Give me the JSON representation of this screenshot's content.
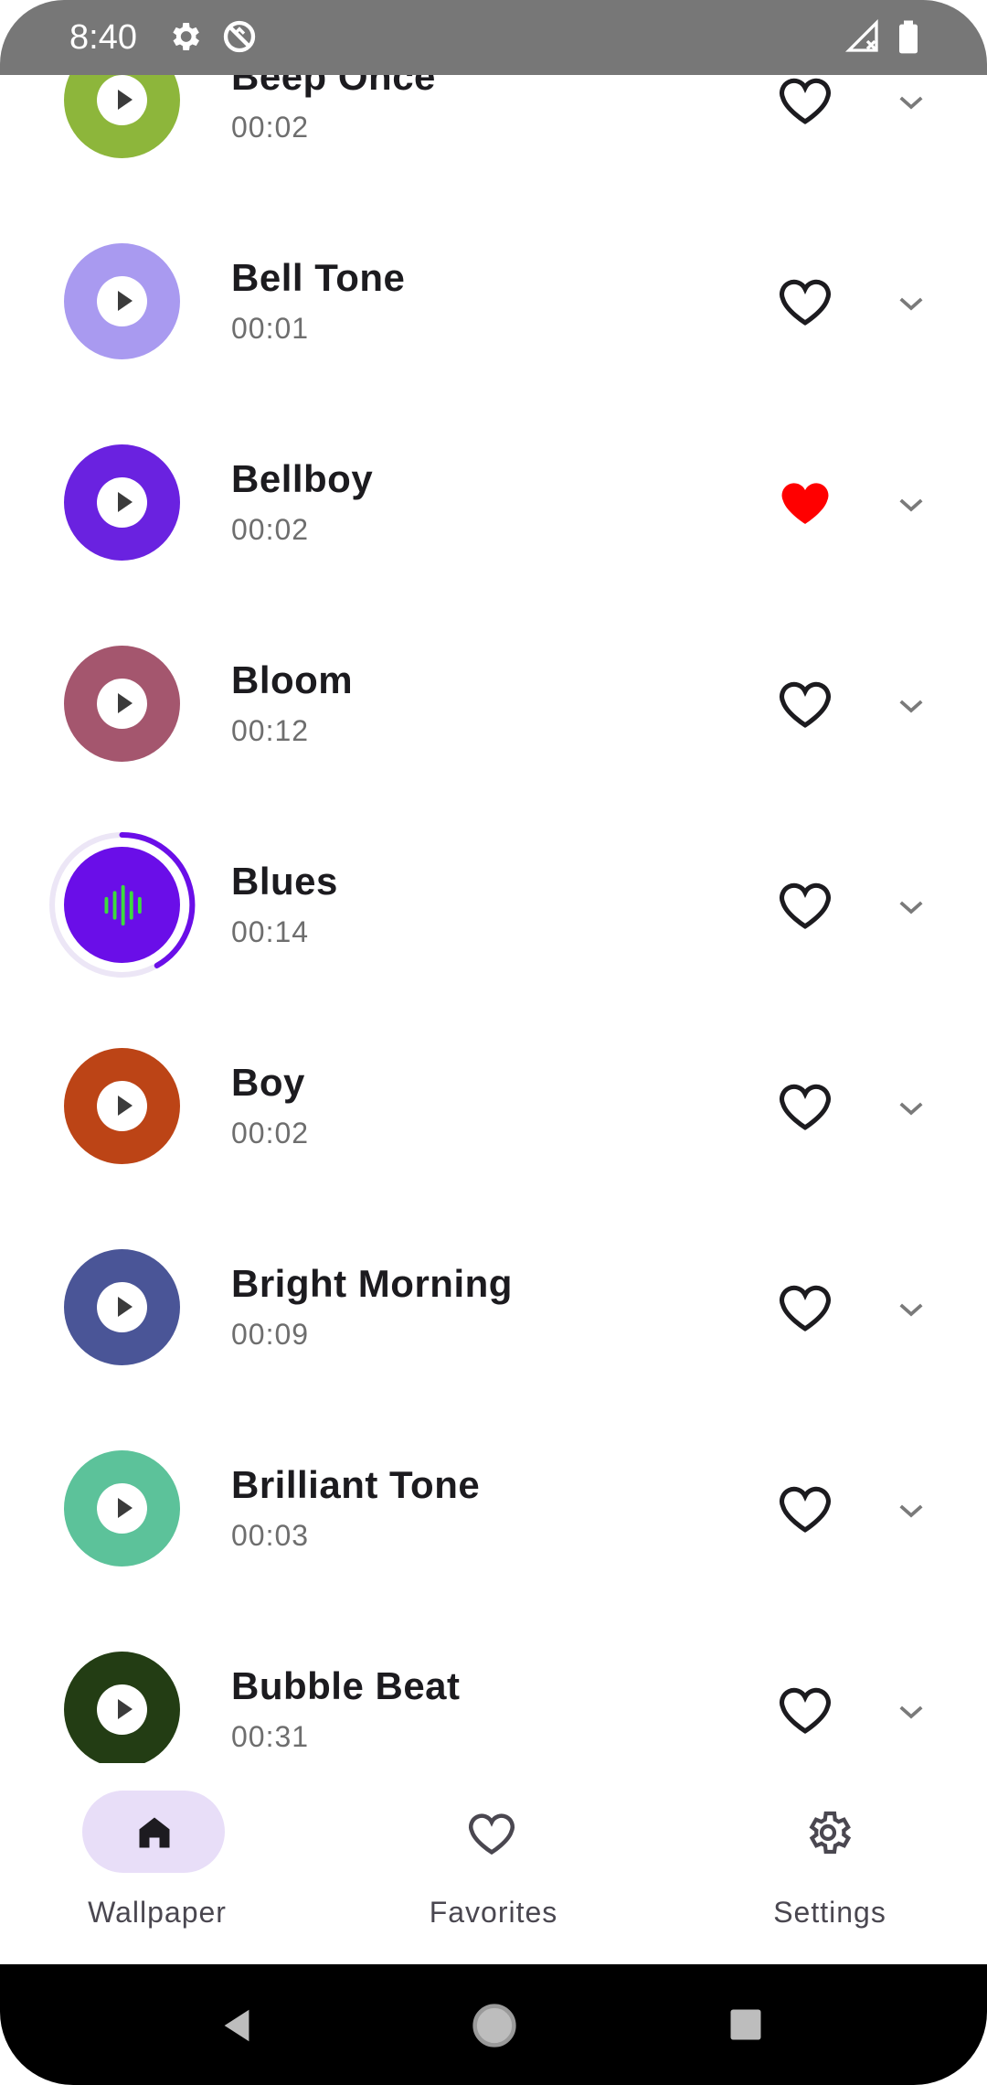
{
  "status_bar": {
    "time": "8:40",
    "icons": [
      "gear-icon",
      "no-sync-icon",
      "signal-off-icon",
      "battery-icon"
    ]
  },
  "colors": {
    "primary": "#6a0ee8",
    "favorite_red": "#ff0000",
    "eq_green": "#3ddc3d",
    "nav_pill": "#e8def8"
  },
  "ringtones": [
    {
      "title": "Beep Once",
      "duration": "00:02",
      "color": "#8db63b",
      "favorite": false,
      "playing": false
    },
    {
      "title": "Bell Tone",
      "duration": "00:01",
      "color": "#a99af0",
      "favorite": false,
      "playing": false
    },
    {
      "title": "Bellboy",
      "duration": "00:02",
      "color": "#6a22e0",
      "favorite": true,
      "playing": false
    },
    {
      "title": "Bloom",
      "duration": "00:12",
      "color": "#a4566e",
      "favorite": false,
      "playing": false
    },
    {
      "title": "Blues",
      "duration": "00:14",
      "color": "#6a0ee8",
      "favorite": false,
      "playing": true
    },
    {
      "title": "Boy",
      "duration": "00:02",
      "color": "#bc4416",
      "favorite": false,
      "playing": false
    },
    {
      "title": "Bright Morning",
      "duration": "00:09",
      "color": "#4a5597",
      "favorite": false,
      "playing": false
    },
    {
      "title": "Brilliant Tone",
      "duration": "00:03",
      "color": "#5cc29a",
      "favorite": false,
      "playing": false
    },
    {
      "title": "Bubble Beat",
      "duration": "00:31",
      "color": "#233d14",
      "favorite": false,
      "playing": false
    }
  ],
  "bottom_nav": {
    "items": [
      {
        "label": "Wallpaper",
        "icon": "home-icon",
        "selected": true
      },
      {
        "label": "Favorites",
        "icon": "heart-outline-icon",
        "selected": false
      },
      {
        "label": "Settings",
        "icon": "gear-icon",
        "selected": false
      }
    ]
  },
  "system_nav": {
    "icons": [
      "back-icon",
      "home-circle-icon",
      "recents-icon"
    ]
  }
}
